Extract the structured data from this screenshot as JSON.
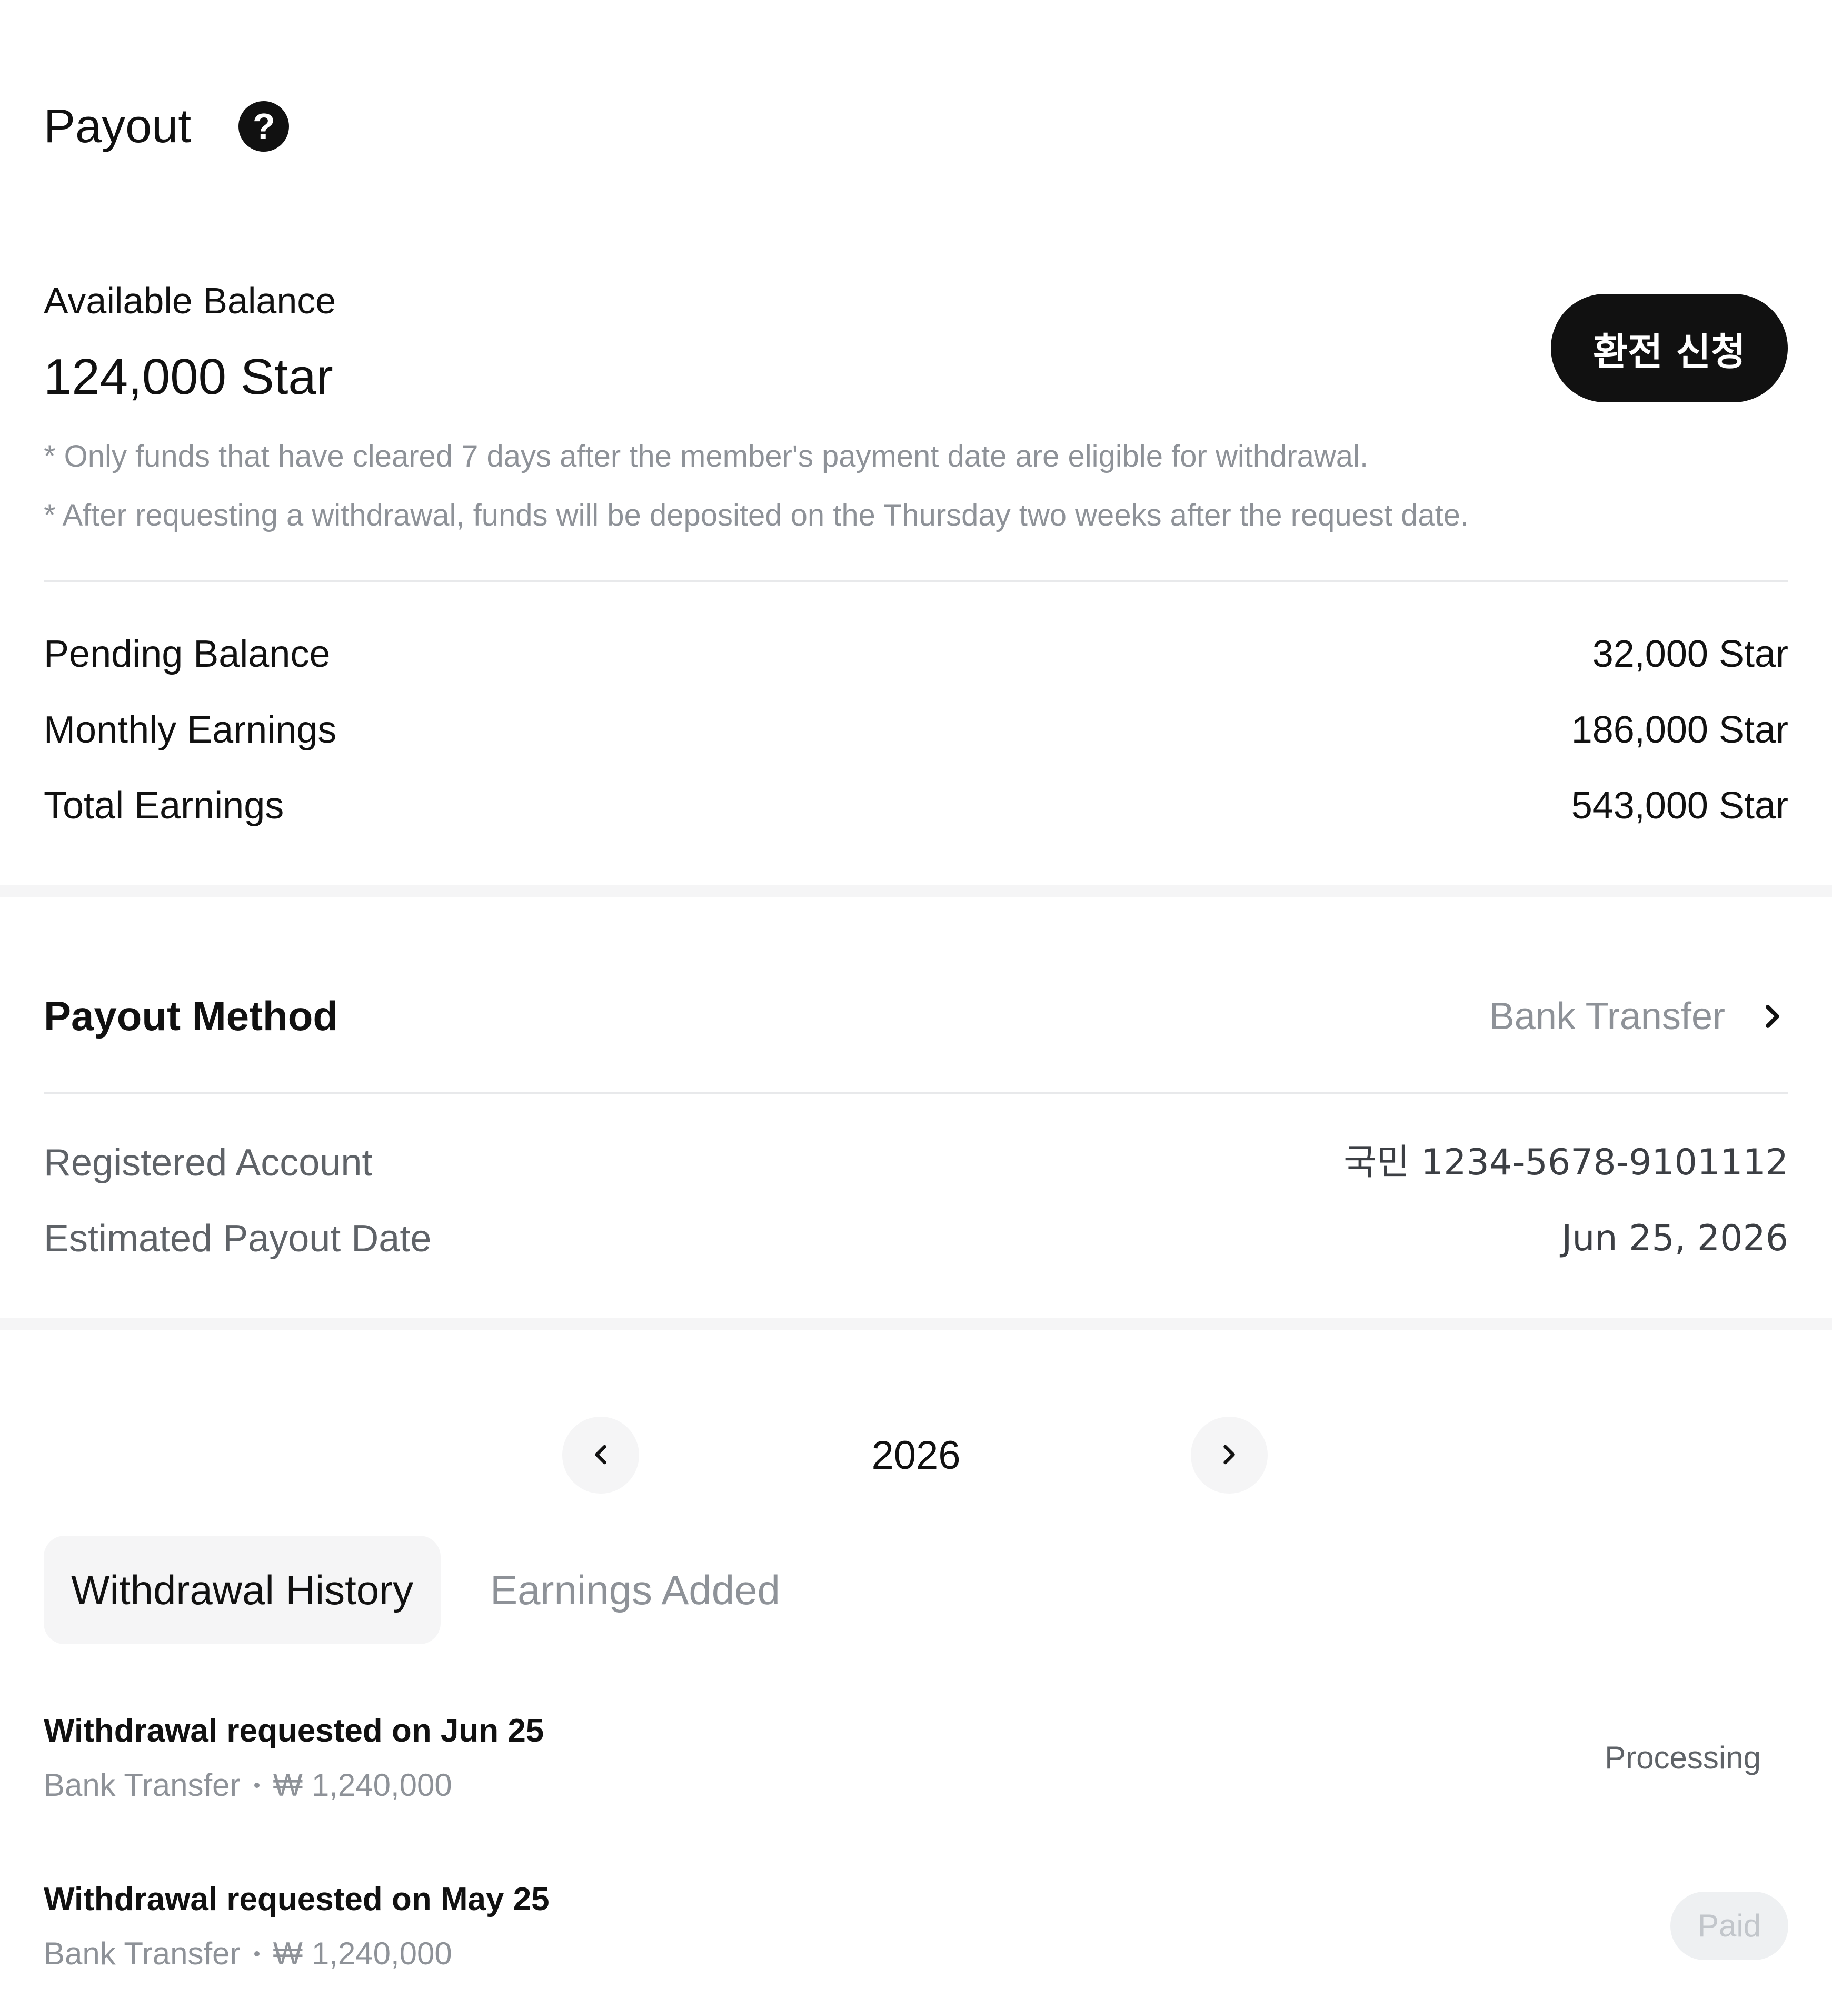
{
  "header": {
    "title": "Payout",
    "help_icon": "?"
  },
  "balance": {
    "label": "Available Balance",
    "value": "124,000 Star",
    "exchange_button": "환전 신청",
    "notes": [
      "* Only funds that have cleared 7 days after the member's payment date are eligible for withdrawal.",
      "* After requesting a withdrawal, funds will be deposited on the Thursday two weeks after the request date."
    ]
  },
  "stats": [
    {
      "label": "Pending Balance",
      "value": "32,000 Star"
    },
    {
      "label": "Monthly Earnings",
      "value": "186,000 Star"
    },
    {
      "label": "Total Earnings",
      "value": "543,000 Star"
    }
  ],
  "payout_method": {
    "title": "Payout Method",
    "value": "Bank Transfer",
    "rows": [
      {
        "label": "Registered Account",
        "value": "국민 1234-5678-9101112"
      },
      {
        "label": "Estimated Payout Date",
        "value": "Jun 25, 2026"
      }
    ]
  },
  "year_nav": {
    "year": "2026"
  },
  "tabs": [
    {
      "label": "Withdrawal History",
      "active": true
    },
    {
      "label": "Earnings Added",
      "active": false
    }
  ],
  "history": [
    {
      "title": "Withdrawal requested on Jun 25",
      "method": "Bank Transfer",
      "amount": "₩ 1,240,000",
      "status": "Processing"
    },
    {
      "title": "Withdrawal requested on May 25",
      "method": "Bank Transfer",
      "amount": "₩ 1,240,000",
      "status": "Paid"
    }
  ],
  "colors": {
    "primary": "#111111",
    "muted": "#8e9298",
    "divider": "#e8e9eb",
    "surface": "#f5f5f6",
    "paid_badge_bg": "#eef0f2",
    "paid_badge_text": "#c2c6cb"
  },
  "icons": {
    "help": "help-circle-icon",
    "method_chevron": "chevron-right-icon",
    "prev_year": "chevron-left-icon",
    "next_year": "chevron-right-icon"
  }
}
